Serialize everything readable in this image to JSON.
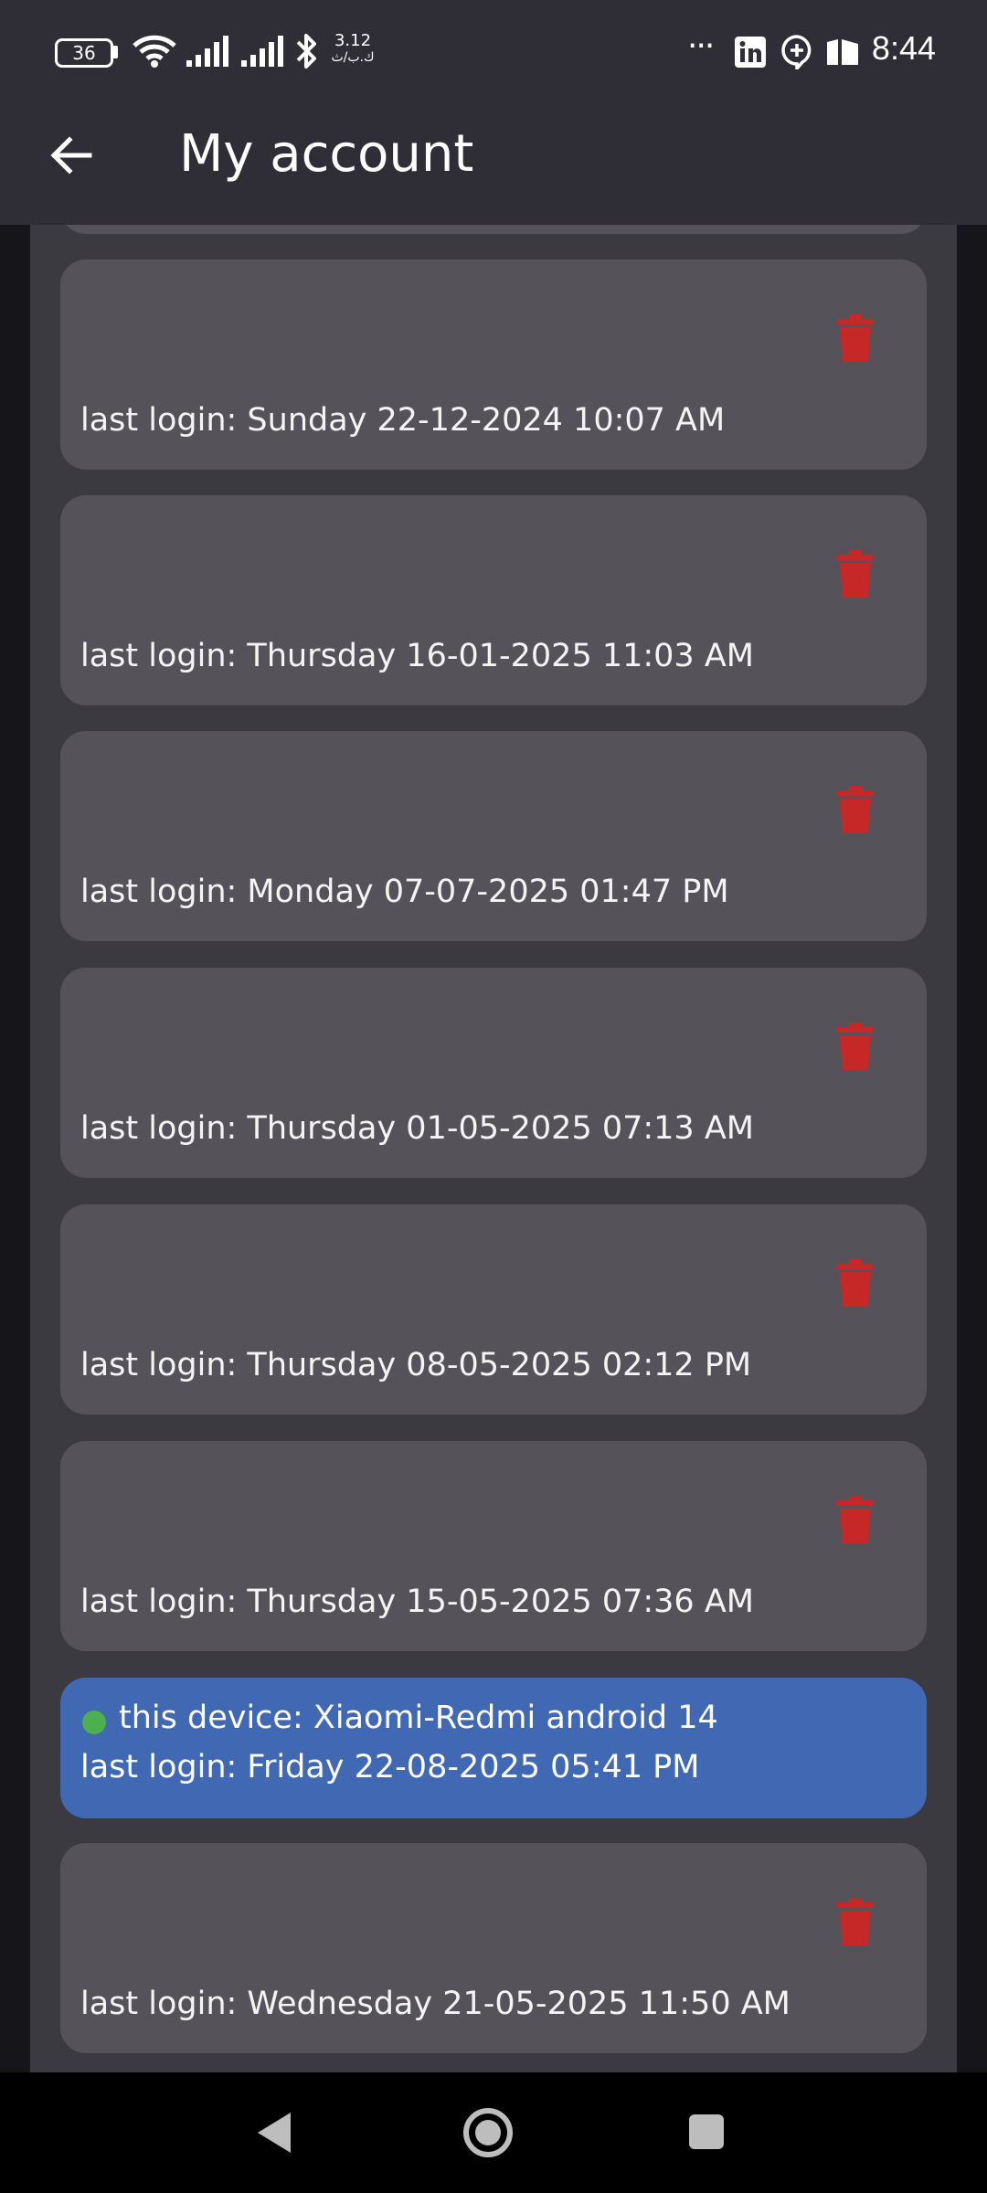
{
  "status_bar": {
    "battery": "36",
    "net_speed_value": "3.12",
    "net_speed_unit": "ك.ب/ث",
    "time": "8:44",
    "overflow": "···",
    "icons": [
      "wifi-icon",
      "signal-icon",
      "signal-icon",
      "bluetooth-icon",
      "linkedin-icon",
      "chat-icon",
      "app-icon"
    ]
  },
  "app_bar": {
    "title": "My account",
    "back_icon": "arrow-left-icon"
  },
  "sessions": [
    {
      "last_login": "last login: Sunday 22-12-2024 10:07 AM"
    },
    {
      "last_login": "last login: Thursday 16-01-2025 11:03 AM"
    },
    {
      "last_login": "last login: Monday 07-07-2025 01:47 PM"
    },
    {
      "last_login": "last login: Thursday 01-05-2025 07:13 AM"
    },
    {
      "last_login": "last login: Thursday 08-05-2025 02:12 PM"
    },
    {
      "last_login": "last login: Thursday 15-05-2025 07:36 AM"
    },
    {
      "last_login": "last login: Wednesday 21-05-2025 11:50 AM"
    }
  ],
  "current_device": {
    "device": "this device: Xiaomi-Redmi  android 14",
    "last_login": "last login: Friday 22-08-2025 05:41 PM"
  },
  "colors": {
    "app_bar": "#2f2e37",
    "content_bg": "#3b3a41",
    "card_bg": "#555359",
    "current_card_bg": "#4169b3",
    "delete_icon": "#c62828",
    "online_dot": "#4caf50"
  }
}
